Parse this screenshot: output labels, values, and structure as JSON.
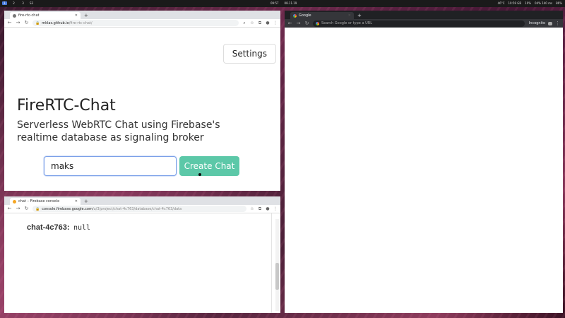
{
  "panel": {
    "workspaces": [
      "1",
      "2",
      "3"
    ],
    "app_label": "S3",
    "time_left": "09:57",
    "date_center": "08.11.19",
    "clock": "10:59 GB",
    "battery": "86%",
    "cpu": "46°C",
    "net": "10%",
    "volume": "04% 140 ms"
  },
  "window_top_left": {
    "tab_title": "fire-rtc-chat",
    "url_host": "mklas.github.io",
    "url_path": "/fire-rtc-chat/",
    "settings_label": "Settings",
    "title": "FireRTC-Chat",
    "subtitle": "Serverless WebRTC Chat using Firebase's realtime database as signaling broker",
    "input_value": "maks",
    "create_label": "Create Chat"
  },
  "window_bottom_left": {
    "tab_title": "chat – Firebase console",
    "url_host": "console.firebase.google.com",
    "url_path": "/u/3/project/chat-4c763/database/chat-4c763/data",
    "key": "chat-4c763",
    "colon": ":",
    "value": "null"
  },
  "window_right": {
    "tab_title": "Google",
    "omnibox_placeholder": "Search Google or type a URL",
    "incognito_label": "Incognito"
  },
  "icons": {
    "back": "back-arrow-icon",
    "forward": "forward-arrow-icon",
    "reload": "reload-icon",
    "lock": "lock-icon",
    "zoom": "zoom-icon",
    "star": "star-icon",
    "account": "account-icon",
    "menu": "menu-dots-icon"
  },
  "colors": {
    "create_button": "#5cc8a8",
    "input_focus": "#7ba0e8",
    "incognito_chrome": "#35363a"
  }
}
